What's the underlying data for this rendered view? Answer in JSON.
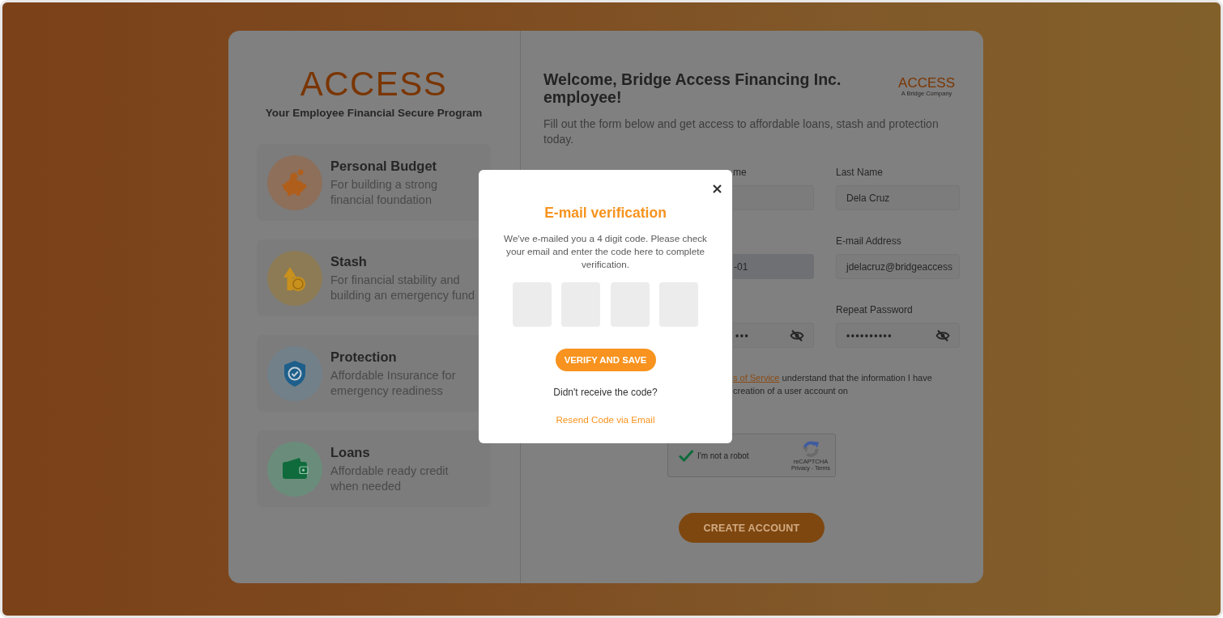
{
  "brand": {
    "logo": "ACCESS",
    "tagline": "Your Employee Financial Secure Program"
  },
  "features": [
    {
      "title": "Personal Budget",
      "description": "For building a strong\nfinancial foundation"
    },
    {
      "title": "Stash",
      "description": "For financial stability and\nbuilding an emergency fund"
    },
    {
      "title": "Protection",
      "description": "Affordable Insurance for\nemergency readiness"
    },
    {
      "title": "Loans",
      "description": "Affordable ready credit\nwhen needed"
    }
  ],
  "header": {
    "title": "Welcome, Bridge Access Financing Inc. employee!",
    "logo": "ACCESS",
    "logo_caption": "A Bridge Company"
  },
  "intro": "Fill out the form below and get access to affordable loans, stash and protection today.",
  "form": {
    "rows": [
      {
        "fields": [
          {
            "kind": "text",
            "label": "me",
            "disabled": false
          },
          {
            "kind": "text",
            "label": "Last Name",
            "value": "Dela Cruz",
            "disabled": false
          }
        ]
      },
      {
        "fields": [
          {
            "kind": "text",
            "value": "-01",
            "disabled": true
          },
          {
            "kind": "text",
            "label": "E-mail Address",
            "value": "jdelacruz@bridgeaccess",
            "disabled": false
          }
        ]
      },
      {
        "fields": [
          {
            "kind": "password",
            "value": "•••",
            "disabled": false
          },
          {
            "kind": "password",
            "label": "Repeat Password",
            "value": "••••••••••",
            "disabled": false
          }
        ]
      }
    ]
  },
  "terms": {
    "lines": [
      [
        {
          "kind": "link",
          "text": "s of Service"
        },
        {
          "kind": "text",
          "text": "understand that the information I have"
        }
      ],
      [
        {
          "kind": "text",
          "text": "creation of a user account on"
        }
      ]
    ]
  },
  "recaptcha": {
    "label": "I'm not a robot",
    "checked": true,
    "brand": "reCAPTCHA",
    "links": "Privacy - Terms"
  },
  "create_button": "CREATE ACCOUNT",
  "dialog": {
    "title": "E-mail verification",
    "message": "We've e-mailed you a 4 digit code. Please check your email and enter the code here to complete verification.",
    "code_fields": [
      {
        "kind": "digit"
      },
      {
        "kind": "digit"
      },
      {
        "kind": "digit"
      },
      {
        "kind": "digit"
      }
    ],
    "button": "VERIFY AND SAVE",
    "prompt": "Didn't receive the code?",
    "resend_link": "Resend Code via Email"
  }
}
